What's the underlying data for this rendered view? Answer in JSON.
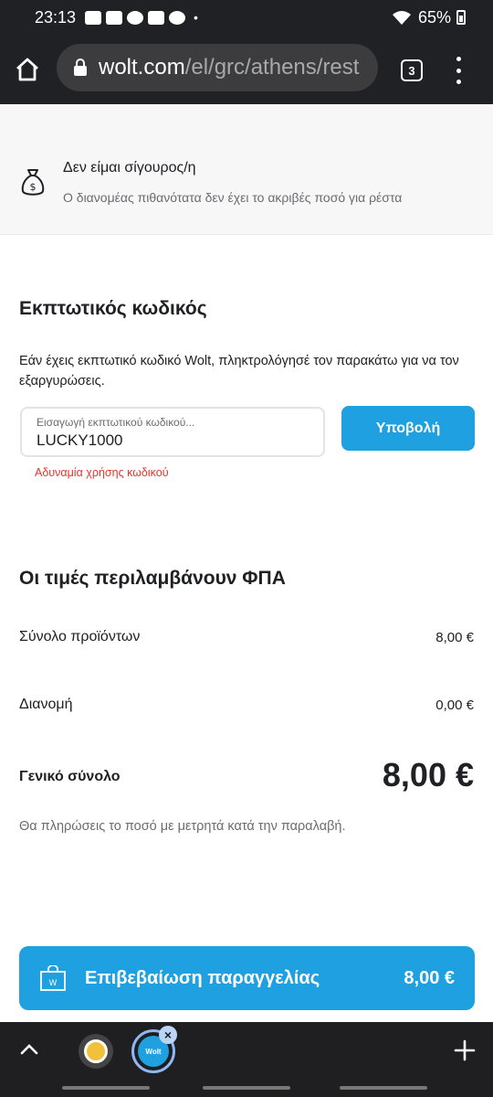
{
  "status_bar": {
    "time": "23:13",
    "battery": "65%",
    "notification_icons": [
      "youtube-icon",
      "youtube-icon",
      "smiley-icon",
      "gallery-icon",
      "g-icon"
    ]
  },
  "browser": {
    "url_host": "wolt.com",
    "url_path": "/el/grc/athens/rest",
    "tab_count": "3"
  },
  "cash_option": {
    "title": "Δεν είμαι σίγουρος/η",
    "subtitle": "Ο διανομέας πιθανότατα δεν έχει το ακριβές ποσό για ρέστα"
  },
  "promo": {
    "title": "Εκπτωτικός κωδικός",
    "description": "Εάν έχεις εκπτωτικό κωδικό Wolt, πληκτρολόγησέ τον παρακάτω για να τον εξαργυρώσεις.",
    "input_label": "Εισαγωγή εκπτωτικού κωδικού...",
    "input_value": "LUCKY1000",
    "submit_label": "Υποβολή",
    "error": "Αδυναμία χρήσης κωδικού"
  },
  "summary": {
    "title": "Οι τιμές περιλαμβάνουν ΦΠΑ",
    "items_label": "Σύνολο προϊόντων",
    "items_value": "8,00 €",
    "delivery_label": "Διανομή",
    "delivery_value": "0,00 €",
    "total_label": "Γενικό σύνολο",
    "total_value": "8,00 €",
    "payment_note": "Θα πληρώσεις το ποσό με μετρητά κατά την παραλαβή."
  },
  "confirm": {
    "label": "Επιβεβαίωση παραγγελίας",
    "price": "8,00 €"
  },
  "bottom_bar": {
    "bubble_text": "Wolt"
  },
  "colors": {
    "accent": "#1fa0e0",
    "error": "#e0362c",
    "chrome_dark": "#202124"
  }
}
